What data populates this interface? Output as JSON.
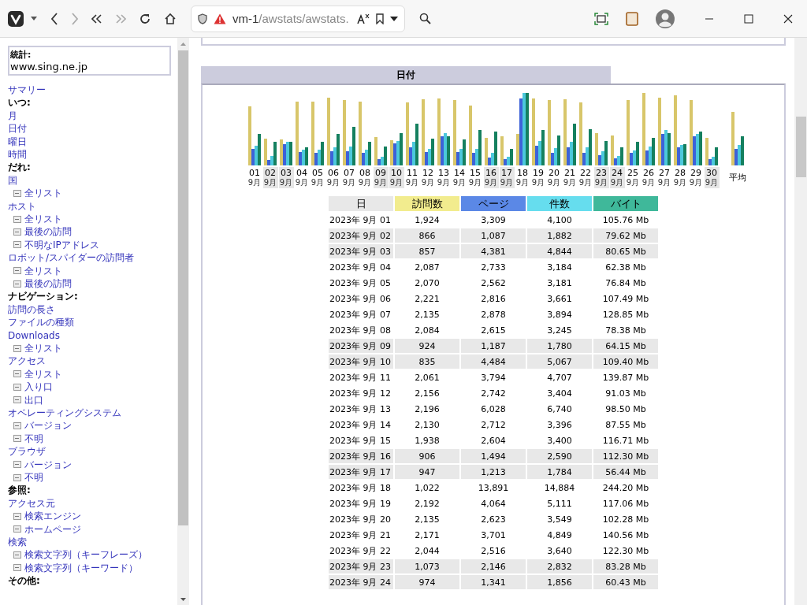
{
  "browser": {
    "url_host": "vm-1",
    "url_path": "/awstats/awstats."
  },
  "sidebar": {
    "title": "統計:",
    "site": "www.sing.ne.jp",
    "items": [
      {
        "kind": "link",
        "label": "サマリー"
      },
      {
        "kind": "heading",
        "label": "いつ:"
      },
      {
        "kind": "link",
        "label": "月"
      },
      {
        "kind": "link",
        "label": "日付"
      },
      {
        "kind": "link",
        "label": "曜日"
      },
      {
        "kind": "link",
        "label": "時間"
      },
      {
        "kind": "heading",
        "label": "だれ:"
      },
      {
        "kind": "link",
        "label": "国"
      },
      {
        "kind": "sub",
        "label": "全リスト"
      },
      {
        "kind": "link",
        "label": "ホスト"
      },
      {
        "kind": "sub",
        "label": "全リスト"
      },
      {
        "kind": "sub",
        "label": "最後の訪問"
      },
      {
        "kind": "sub",
        "label": "不明なIPアドレス"
      },
      {
        "kind": "link",
        "label": "ロボット/スパイダーの訪問者"
      },
      {
        "kind": "sub",
        "label": "全リスト"
      },
      {
        "kind": "sub",
        "label": "最後の訪問"
      },
      {
        "kind": "heading",
        "label": "ナビゲーション:"
      },
      {
        "kind": "link",
        "label": "訪問の長さ"
      },
      {
        "kind": "link",
        "label": "ファイルの種類"
      },
      {
        "kind": "link",
        "label": "Downloads"
      },
      {
        "kind": "sub",
        "label": "全リスト"
      },
      {
        "kind": "link",
        "label": "アクセス"
      },
      {
        "kind": "sub",
        "label": "全リスト"
      },
      {
        "kind": "sub",
        "label": "入り口"
      },
      {
        "kind": "sub",
        "label": "出口"
      },
      {
        "kind": "link",
        "label": "オペレーティングシステム"
      },
      {
        "kind": "sub",
        "label": "バージョン"
      },
      {
        "kind": "sub",
        "label": "不明"
      },
      {
        "kind": "link",
        "label": "ブラウザ"
      },
      {
        "kind": "sub",
        "label": "バージョン"
      },
      {
        "kind": "sub",
        "label": "不明"
      },
      {
        "kind": "heading",
        "label": "参照:"
      },
      {
        "kind": "link",
        "label": "アクセス元"
      },
      {
        "kind": "sub",
        "label": "検索エンジン"
      },
      {
        "kind": "sub",
        "label": "ホームページ"
      },
      {
        "kind": "link",
        "label": "検索"
      },
      {
        "kind": "sub",
        "label": "検索文字列（キーフレーズ）"
      },
      {
        "kind": "sub",
        "label": "検索文字列（キーワード）"
      },
      {
        "kind": "heading",
        "label": "その他:"
      }
    ]
  },
  "section": {
    "title": "日付",
    "chart": {
      "labels": [
        {
          "day": "01",
          "month": "9月",
          "highlighted": false
        },
        {
          "day": "02",
          "month": "9月",
          "highlighted": true
        },
        {
          "day": "03",
          "month": "9月",
          "highlighted": true
        },
        {
          "day": "04",
          "month": "9月",
          "highlighted": false
        },
        {
          "day": "05",
          "month": "9月",
          "highlighted": false
        },
        {
          "day": "06",
          "month": "9月",
          "highlighted": false
        },
        {
          "day": "07",
          "month": "9月",
          "highlighted": false
        },
        {
          "day": "08",
          "month": "9月",
          "highlighted": false
        },
        {
          "day": "09",
          "month": "9月",
          "highlighted": true
        },
        {
          "day": "10",
          "month": "9月",
          "highlighted": true
        },
        {
          "day": "11",
          "month": "9月",
          "highlighted": false
        },
        {
          "day": "12",
          "month": "9月",
          "highlighted": false
        },
        {
          "day": "13",
          "month": "9月",
          "highlighted": false
        },
        {
          "day": "14",
          "month": "9月",
          "highlighted": false
        },
        {
          "day": "15",
          "month": "9月",
          "highlighted": false
        },
        {
          "day": "16",
          "month": "9月",
          "highlighted": true
        },
        {
          "day": "17",
          "month": "9月",
          "highlighted": true
        },
        {
          "day": "18",
          "month": "9月",
          "highlighted": false
        },
        {
          "day": "19",
          "month": "9月",
          "highlighted": false
        },
        {
          "day": "20",
          "month": "9月",
          "highlighted": false
        },
        {
          "day": "21",
          "month": "9月",
          "highlighted": false
        },
        {
          "day": "22",
          "month": "9月",
          "highlighted": false
        },
        {
          "day": "23",
          "month": "9月",
          "highlighted": true
        },
        {
          "day": "24",
          "month": "9月",
          "highlighted": true
        },
        {
          "day": "25",
          "month": "9月",
          "highlighted": false
        },
        {
          "day": "26",
          "month": "9月",
          "highlighted": false
        },
        {
          "day": "27",
          "month": "9月",
          "highlighted": false
        },
        {
          "day": "28",
          "month": "9月",
          "highlighted": false
        },
        {
          "day": "29",
          "month": "9月",
          "highlighted": false
        },
        {
          "day": "30",
          "month": "9月",
          "highlighted": true
        }
      ],
      "average_label": "平均"
    },
    "table": {
      "columns": [
        {
          "label": "日",
          "kind": "date"
        },
        {
          "label": "訪問数",
          "kind": "visits"
        },
        {
          "label": "ページ",
          "kind": "pages"
        },
        {
          "label": "件数",
          "kind": "hits"
        },
        {
          "label": "バイト",
          "kind": "bytes"
        }
      ],
      "rows": [
        {
          "cells": [
            "2023年 9月 01",
            "1,924",
            "3,309",
            "4,100",
            "105.76 Mb"
          ],
          "highlighted": false
        },
        {
          "cells": [
            "2023年 9月 02",
            "866",
            "1,087",
            "1,882",
            "79.62 Mb"
          ],
          "highlighted": true
        },
        {
          "cells": [
            "2023年 9月 03",
            "857",
            "4,381",
            "4,844",
            "80.65 Mb"
          ],
          "highlighted": true
        },
        {
          "cells": [
            "2023年 9月 04",
            "2,087",
            "2,733",
            "3,184",
            "62.38 Mb"
          ],
          "highlighted": false
        },
        {
          "cells": [
            "2023年 9月 05",
            "2,070",
            "2,562",
            "3,181",
            "76.84 Mb"
          ],
          "highlighted": false
        },
        {
          "cells": [
            "2023年 9月 06",
            "2,221",
            "2,816",
            "3,661",
            "107.49 Mb"
          ],
          "highlighted": false
        },
        {
          "cells": [
            "2023年 9月 07",
            "2,135",
            "2,878",
            "3,894",
            "128.85 Mb"
          ],
          "highlighted": false
        },
        {
          "cells": [
            "2023年 9月 08",
            "2,084",
            "2,615",
            "3,245",
            "78.38 Mb"
          ],
          "highlighted": false
        },
        {
          "cells": [
            "2023年 9月 09",
            "924",
            "1,187",
            "1,780",
            "64.15 Mb"
          ],
          "highlighted": true
        },
        {
          "cells": [
            "2023年 9月 10",
            "835",
            "4,484",
            "5,067",
            "109.40 Mb"
          ],
          "highlighted": true
        },
        {
          "cells": [
            "2023年 9月 11",
            "2,061",
            "3,794",
            "4,707",
            "139.87 Mb"
          ],
          "highlighted": false
        },
        {
          "cells": [
            "2023年 9月 12",
            "2,156",
            "2,742",
            "3,404",
            "91.03 Mb"
          ],
          "highlighted": false
        },
        {
          "cells": [
            "2023年 9月 13",
            "2,196",
            "6,028",
            "6,740",
            "98.50 Mb"
          ],
          "highlighted": false
        },
        {
          "cells": [
            "2023年 9月 14",
            "2,130",
            "2,712",
            "3,396",
            "87.55 Mb"
          ],
          "highlighted": false
        },
        {
          "cells": [
            "2023年 9月 15",
            "1,938",
            "2,604",
            "3,400",
            "116.71 Mb"
          ],
          "highlighted": false
        },
        {
          "cells": [
            "2023年 9月 16",
            "906",
            "1,494",
            "2,590",
            "112.30 Mb"
          ],
          "highlighted": true
        },
        {
          "cells": [
            "2023年 9月 17",
            "947",
            "1,213",
            "1,784",
            "56.44 Mb"
          ],
          "highlighted": true
        },
        {
          "cells": [
            "2023年 9月 18",
            "1,022",
            "13,891",
            "14,884",
            "244.20 Mb"
          ],
          "highlighted": false
        },
        {
          "cells": [
            "2023年 9月 19",
            "2,192",
            "4,064",
            "5,111",
            "117.06 Mb"
          ],
          "highlighted": false
        },
        {
          "cells": [
            "2023年 9月 20",
            "2,135",
            "2,623",
            "3,549",
            "102.28 Mb"
          ],
          "highlighted": false
        },
        {
          "cells": [
            "2023年 9月 21",
            "2,171",
            "3,701",
            "4,849",
            "140.56 Mb"
          ],
          "highlighted": false
        },
        {
          "cells": [
            "2023年 9月 22",
            "2,044",
            "2,516",
            "3,640",
            "122.30 Mb"
          ],
          "highlighted": false
        },
        {
          "cells": [
            "2023年 9月 23",
            "1,073",
            "2,146",
            "2,832",
            "83.28 Mb"
          ],
          "highlighted": true
        },
        {
          "cells": [
            "2023年 9月 24",
            "974",
            "1,341",
            "1,856",
            "60.43 Mb"
          ],
          "highlighted": true
        }
      ]
    }
  }
}
